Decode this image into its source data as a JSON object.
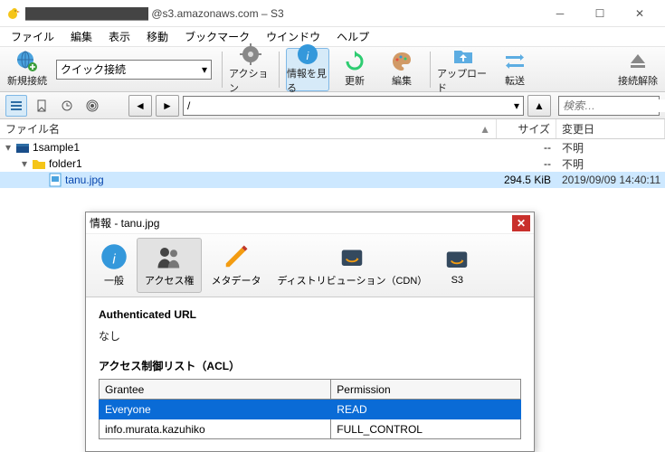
{
  "window": {
    "title": "@s3.amazonaws.com – S3",
    "prefix_redacted": "████████████████"
  },
  "menu": [
    "ファイル",
    "編集",
    "表示",
    "移動",
    "ブックマーク",
    "ウインドウ",
    "ヘルプ"
  ],
  "toolbar": {
    "new_connection": "新規接続",
    "quick_connect": "クイック接続",
    "action": "アクション",
    "info": "情報を見る",
    "refresh": "更新",
    "edit": "編集",
    "upload": "アップロード",
    "transfer": "転送",
    "disconnect": "接続解除"
  },
  "pathbar": {
    "path": "/",
    "search_placeholder": "検索…"
  },
  "columns": {
    "name": "ファイル名",
    "size": "サイズ",
    "modified": "変更日"
  },
  "files": [
    {
      "name": "1sample1",
      "size": "--",
      "modified": "不明",
      "depth": 0,
      "type": "bucket",
      "expanded": true
    },
    {
      "name": "folder1",
      "size": "--",
      "modified": "不明",
      "depth": 1,
      "type": "folder",
      "expanded": true
    },
    {
      "name": "tanu.jpg",
      "size": "294.5 KiB",
      "modified": "2019/09/09 14:40:11",
      "depth": 2,
      "type": "file",
      "selected": true
    }
  ],
  "dialog": {
    "title": "情報 - tanu.jpg",
    "tabs": {
      "general": "一般",
      "permissions": "アクセス権",
      "metadata": "メタデータ",
      "cdn": "ディストリビューション（CDN）",
      "s3": "S3"
    },
    "auth_url_label": "Authenticated URL",
    "auth_url_value": "なし",
    "acl_label": "アクセス制御リスト（ACL）",
    "acl_headers": {
      "grantee": "Grantee",
      "permission": "Permission"
    },
    "acl_rows": [
      {
        "grantee": "Everyone",
        "permission": "READ",
        "selected": true
      },
      {
        "grantee": "info.murata.kazuhiko",
        "permission": "FULL_CONTROL",
        "selected": false
      }
    ]
  }
}
